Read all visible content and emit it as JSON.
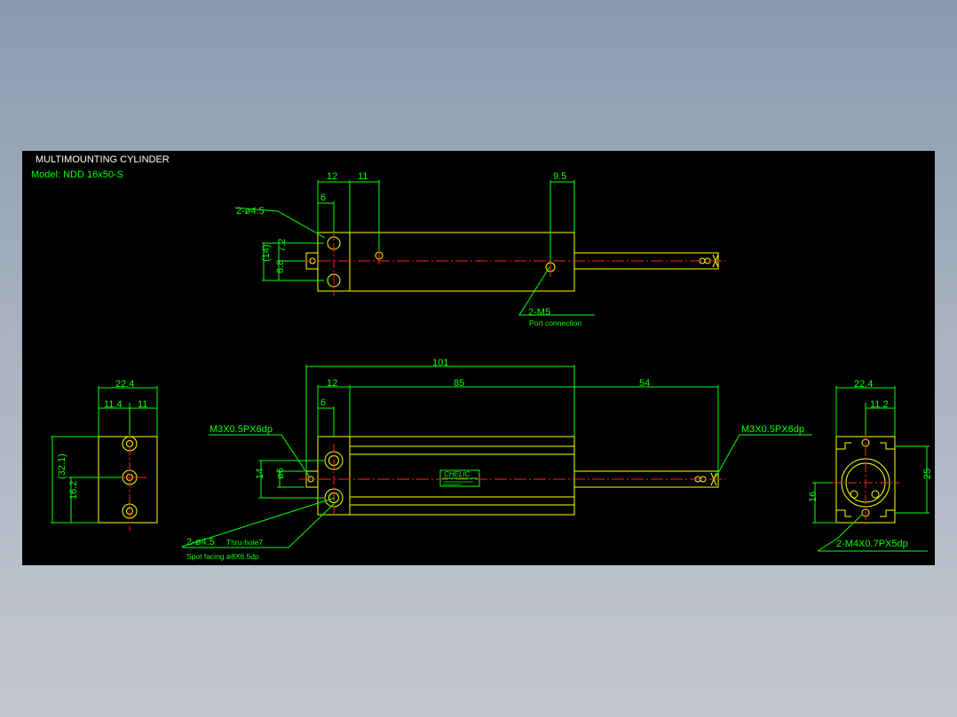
{
  "colors": {
    "canvas": "#000000",
    "outline": "#ffff00",
    "dimension": "#00ff00",
    "centerline": "#ff2020",
    "title": "#ffffff"
  },
  "title_block": {
    "title": "MULTIMOUNTING CYLINDER",
    "model": "Model: NDD 16x50-S"
  },
  "top_view": {
    "dims": [
      "12",
      "11",
      "6",
      "9.5",
      "(14)",
      "6.8",
      "7.2"
    ],
    "callout_holes": "2-ø4.5",
    "callout_port": "2-M5",
    "callout_port_note": "Port connection"
  },
  "front_view": {
    "dims": [
      "101",
      "12",
      "85",
      "54",
      "6",
      "14",
      "ø6"
    ],
    "callout_left_thread": "M3X0.5PX6dp",
    "callout_right_thread": "M3X0.5PX6dp",
    "callout_holes": "2-ø4.5",
    "callout_holes_note": "Thru-hole7",
    "callout_spot": "Spot facing ø8X6.5dp",
    "nameplate": "CHELIC"
  },
  "left_view": {
    "dims": [
      "22.4",
      "11.4",
      "11",
      "(32.1)",
      "16.2"
    ]
  },
  "right_view": {
    "dims": [
      "22.4",
      "11.2",
      "25",
      "16"
    ],
    "callout_thread": "2-M4X0.7PX5dp"
  }
}
